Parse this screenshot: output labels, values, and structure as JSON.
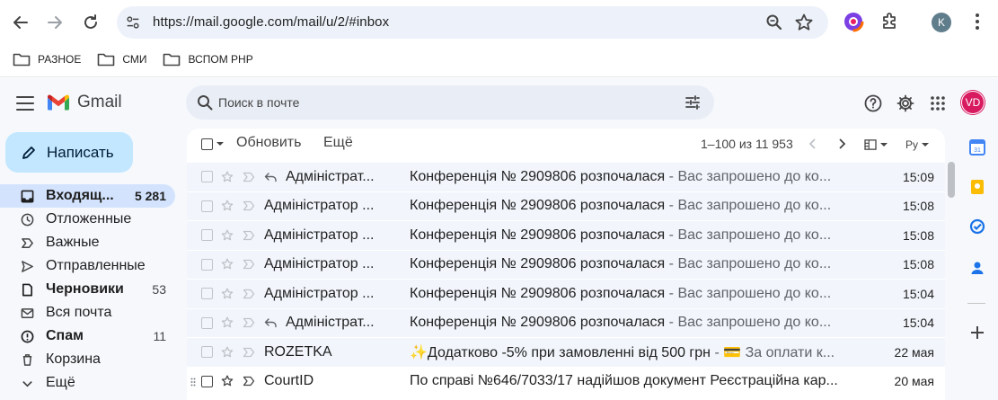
{
  "browser": {
    "url": "https://mail.google.com/mail/u/2/#inbox",
    "profile_initial": "K",
    "bookmarks": [
      {
        "label": "РАЗНОЕ",
        "icon": "folder-icon"
      },
      {
        "label": "СМИ",
        "icon": "folder-icon"
      },
      {
        "label": "ВСПОМ PHP",
        "icon": "folder-icon"
      }
    ]
  },
  "gmail": {
    "app_name": "Gmail",
    "search_placeholder": "Поиск в почте",
    "avatar_initials": "VD",
    "compose_label": "Написать",
    "nav": [
      {
        "label": "Входящ...",
        "count": "5 281",
        "icon": "inbox-icon",
        "active": true,
        "bold": true
      },
      {
        "label": "Отложенные",
        "count": "",
        "icon": "clock-icon",
        "active": false,
        "bold": false
      },
      {
        "label": "Важные",
        "count": "",
        "icon": "important-icon",
        "active": false,
        "bold": false
      },
      {
        "label": "Отправленные",
        "count": "",
        "icon": "send-icon",
        "active": false,
        "bold": false
      },
      {
        "label": "Черновики",
        "count": "53",
        "icon": "draft-icon",
        "active": false,
        "bold": true
      },
      {
        "label": "Вся почта",
        "count": "",
        "icon": "all-mail-icon",
        "active": false,
        "bold": false
      },
      {
        "label": "Спам",
        "count": "11",
        "icon": "spam-icon",
        "active": false,
        "bold": true
      },
      {
        "label": "Корзина",
        "count": "",
        "icon": "trash-icon",
        "active": false,
        "bold": false
      },
      {
        "label": "Ещё",
        "count": "",
        "icon": "chevron-down-icon",
        "active": false,
        "bold": false
      }
    ],
    "toolbar": {
      "refresh_label": "Обновить",
      "more_label": "Ещё",
      "pager_text": "1–100 из 11 953",
      "lang_label": "Ру"
    },
    "emails": [
      {
        "sender": "Адміністрат...",
        "reply": true,
        "subject": "Конференція № 2909806 розпочалася",
        "snippet": " - Вас запрошено до ко...",
        "time": "15:09",
        "unread": false
      },
      {
        "sender": "Адміністратор ...",
        "reply": false,
        "subject": "Конференція № 2909806 розпочалася",
        "snippet": " - Вас запрошено до ко...",
        "time": "15:08",
        "unread": false
      },
      {
        "sender": "Адміністратор ...",
        "reply": false,
        "subject": "Конференція № 2909806 розпочалася",
        "snippet": " - Вас запрошено до ко...",
        "time": "15:08",
        "unread": false
      },
      {
        "sender": "Адміністратор ...",
        "reply": false,
        "subject": "Конференція № 2909806 розпочалася",
        "snippet": " - Вас запрошено до ко...",
        "time": "15:08",
        "unread": false
      },
      {
        "sender": "Адміністратор ...",
        "reply": false,
        "subject": "Конференція № 2909806 розпочалася",
        "snippet": " - Вас запрошено до ко...",
        "time": "15:04",
        "unread": false
      },
      {
        "sender": "Адміністрат...",
        "reply": true,
        "subject": "Конференція № 2909806 розпочалася",
        "snippet": " - Вас запрошено до ко...",
        "time": "15:04",
        "unread": false
      },
      {
        "sender": "ROZETKA",
        "reply": false,
        "subject": "✨Додатково -5% при замовленні від 500 грн",
        "snippet": " - 💳 За оплати к...",
        "time": "22 мая",
        "unread": false
      },
      {
        "sender": "CourtID",
        "reply": false,
        "subject": "По справі №646/7033/17 надійшов документ Реєстраційна кар...",
        "snippet": "",
        "time": "20 мая",
        "unread": true
      }
    ]
  },
  "colors": {
    "gmail_bg": "#f6f8fc",
    "compose_bg": "#c2e7ff",
    "active_nav": "#d3e3fd",
    "avatar": "#d81b60"
  }
}
